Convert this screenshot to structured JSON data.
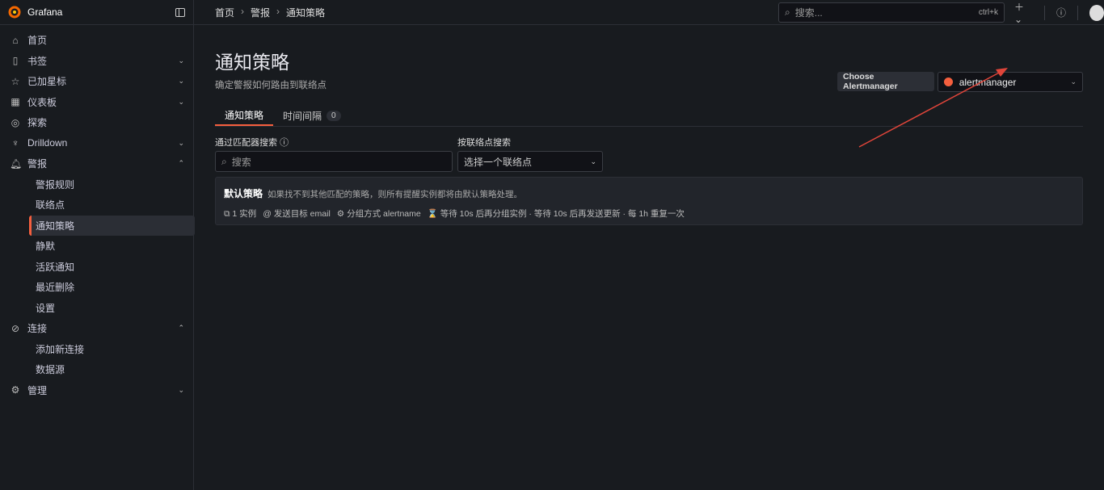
{
  "brand": "Grafana",
  "nav": [
    {
      "label": "首页",
      "icon": "home-icon",
      "chev": ""
    },
    {
      "label": "书签",
      "icon": "bookmark-icon",
      "chev": "⌄"
    },
    {
      "label": "已加星标",
      "icon": "star-icon",
      "chev": "⌄"
    },
    {
      "label": "仪表板",
      "icon": "apps-icon",
      "chev": "⌄"
    },
    {
      "label": "探索",
      "icon": "compass-icon",
      "chev": ""
    },
    {
      "label": "Drilldown",
      "icon": "drilldown-icon",
      "chev": "⌄"
    },
    {
      "label": "警报",
      "icon": "bell-icon",
      "chev": "⌃"
    }
  ],
  "alert_sub": [
    "警报规则",
    "联络点",
    "通知策略",
    "静默",
    "活跃通知",
    "最近删除",
    "设置"
  ],
  "conn": {
    "label": "连接",
    "chev": "⌃"
  },
  "conn_sub": [
    "添加新连接",
    "数据源"
  ],
  "admin": {
    "label": "管理",
    "chev": "⌄"
  },
  "breadcrumb": [
    "首页",
    "警报",
    "通知策略"
  ],
  "search": {
    "placeholder": "搜索...",
    "shortcut": "ctrl+k"
  },
  "page": {
    "title": "通知策略",
    "subtitle": "确定警报如何路由到联络点"
  },
  "alertmanager": {
    "label": "Choose Alertmanager",
    "value": "alertmanager"
  },
  "tabs": [
    {
      "label": "通知策略"
    },
    {
      "label": "时间间隔",
      "count": "0"
    }
  ],
  "filters": {
    "matcher_label": "通过匹配器搜索",
    "matcher_placeholder": "搜索",
    "contact_label": "按联络点搜索",
    "contact_value": "选择一个联络点"
  },
  "policy": {
    "name": "默认策略",
    "desc": "如果找不到其他匹配的策略，则所有提醒实例都将由默认策略处理。",
    "instances": "1 实例",
    "target": "发送目标 email",
    "group": "分组方式 alertname",
    "timing": "等待 10s 后再分组实例 · 等待 10s 后再发送更新 · 每 1h 重复一次"
  }
}
